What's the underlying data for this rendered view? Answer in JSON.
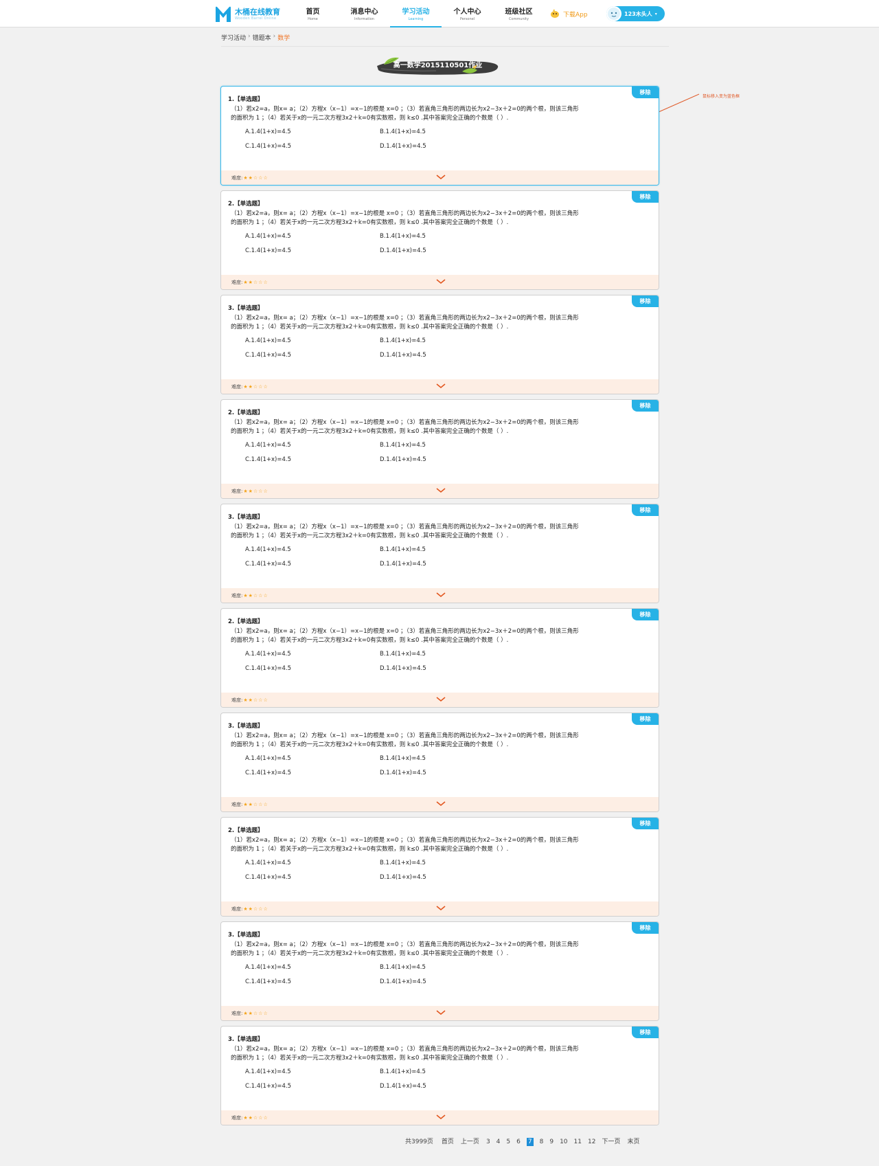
{
  "header": {
    "logo_cn": "木桶在线教育",
    "logo_en": "Wooden Barrel Online",
    "nav": [
      {
        "cn": "首页",
        "en": "Home",
        "active": false
      },
      {
        "cn": "消息中心",
        "en": "Information",
        "active": false
      },
      {
        "cn": "学习活动",
        "en": "Learning",
        "active": true
      },
      {
        "cn": "个人中心",
        "en": "Personel",
        "active": false
      },
      {
        "cn": "班级社区",
        "en": "Community",
        "active": false
      }
    ],
    "download_label": "下载App",
    "user_name": "123木头人",
    "accent_color": "#27b2e6"
  },
  "breadcrumb": {
    "items": [
      "学习活动",
      "错题本"
    ],
    "separator": "›",
    "current": "数学"
  },
  "title": "高一数学2015110501作业",
  "annotation": "鼠标移入变为蓝色框",
  "question_common": {
    "type_label": "【单选题】",
    "remove_label": "移除",
    "body_line1": "（1）若x2=a，则x= a；（2）方程x（x−1）=x−1的根是 x=0 ；（3）若直角三角形的两边长为x2−3x＋2=0的两个根，则该三角形",
    "body_line2": "的面积为 1 ；（4）若关于x的一元二次方程3x2＋k=0有实数根，则 k≤0 .其中答案完全正确的个数是（   ）.",
    "options": [
      "A.1.4(1+x)=4.5",
      "B.1.4(1+x)=4.5",
      "C.1.4(1+x)=4.5",
      "D.1.4(1+x)=4.5"
    ],
    "difficulty_label": "难度:",
    "difficulty_stars": "★★☆☆☆"
  },
  "questions": [
    {
      "number": "1.",
      "hover": true
    },
    {
      "number": "2.",
      "hover": false
    },
    {
      "number": "3.",
      "hover": false
    },
    {
      "number": "2.",
      "hover": false
    },
    {
      "number": "3.",
      "hover": false
    },
    {
      "number": "2.",
      "hover": false
    },
    {
      "number": "3.",
      "hover": false
    },
    {
      "number": "2.",
      "hover": false
    },
    {
      "number": "3.",
      "hover": false
    },
    {
      "number": "3.",
      "hover": false
    }
  ],
  "pagination": {
    "total": "共3999页",
    "first": "首页",
    "prev": "上一页",
    "pages": [
      "3",
      "4",
      "5",
      "6",
      "7",
      "8",
      "9",
      "10",
      "11",
      "12"
    ],
    "current": "7",
    "next": "下一页",
    "last": "末页"
  }
}
